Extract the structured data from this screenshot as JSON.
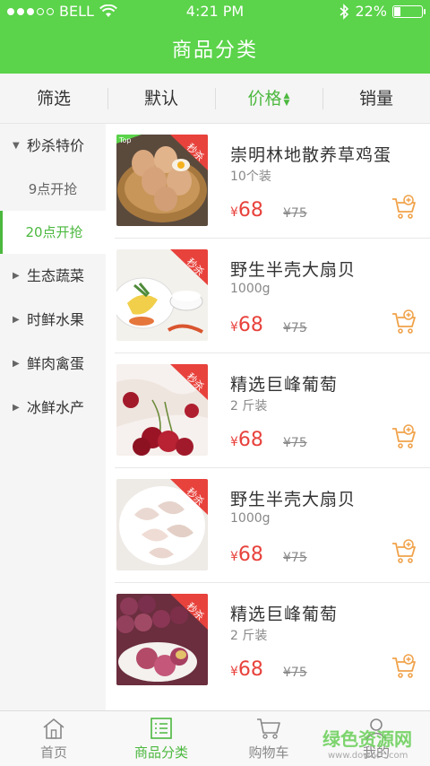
{
  "status_bar": {
    "carrier": "BELL",
    "time": "4:21 PM",
    "battery": "22%",
    "battery_level": 0.22
  },
  "header": {
    "title": "商品分类"
  },
  "filters": [
    {
      "label": "筛选",
      "active": false
    },
    {
      "label": "默认",
      "active": false
    },
    {
      "label": "价格",
      "active": true,
      "icon": "sort-updown-icon"
    },
    {
      "label": "销量",
      "active": false
    }
  ],
  "sidebar": {
    "categories": [
      {
        "label": "秒杀特价",
        "icon": "caret-down-icon",
        "expanded": true,
        "children": [
          {
            "label": "9点开抢",
            "active": false
          },
          {
            "label": "20点开抢",
            "active": true
          }
        ]
      },
      {
        "label": "生态蔬菜",
        "icon": "caret-right-icon"
      },
      {
        "label": "时鲜水果",
        "icon": "caret-right-icon"
      },
      {
        "label": "鲜肉禽蛋",
        "icon": "caret-right-icon"
      },
      {
        "label": "冰鲜水产",
        "icon": "caret-right-icon"
      }
    ]
  },
  "products": [
    {
      "name": "崇明林地散养草鸡蛋",
      "spec": "10个装",
      "currency": "¥",
      "price": "68",
      "old_price": "¥75",
      "badge": "秒杀",
      "tag": "Top",
      "image": "eggs-image"
    },
    {
      "name": "野生半壳大扇贝",
      "spec": "1000g",
      "currency": "¥",
      "price": "68",
      "old_price": "¥75",
      "badge": "秒杀",
      "image": "scallop-dish-image"
    },
    {
      "name": "精选巨峰葡萄",
      "spec": "2 斤装",
      "currency": "¥",
      "price": "68",
      "old_price": "¥75",
      "badge": "秒杀",
      "image": "cherries-image"
    },
    {
      "name": "野生半壳大扇贝",
      "spec": "1000g",
      "currency": "¥",
      "price": "68",
      "old_price": "¥75",
      "badge": "秒杀",
      "image": "shrimp-image"
    },
    {
      "name": "精选巨峰葡萄",
      "spec": "2 斤装",
      "currency": "¥",
      "price": "68",
      "old_price": "¥75",
      "badge": "秒杀",
      "image": "grapes-image"
    }
  ],
  "tabbar": [
    {
      "label": "首页",
      "icon": "home-icon",
      "active": false
    },
    {
      "label": "商品分类",
      "icon": "list-icon",
      "active": true
    },
    {
      "label": "购物车",
      "icon": "cart-icon",
      "active": false
    },
    {
      "label": "我的",
      "icon": "user-icon",
      "active": false
    }
  ],
  "watermark": {
    "main": "绿色资源网",
    "sub": "www.downcc.com"
  },
  "colors": {
    "brand_green": "#5bd34a",
    "active_green": "#4cb83f",
    "price_red": "#e8423c",
    "cart_orange": "#f0a24a",
    "badge_red": "#e8423c"
  }
}
